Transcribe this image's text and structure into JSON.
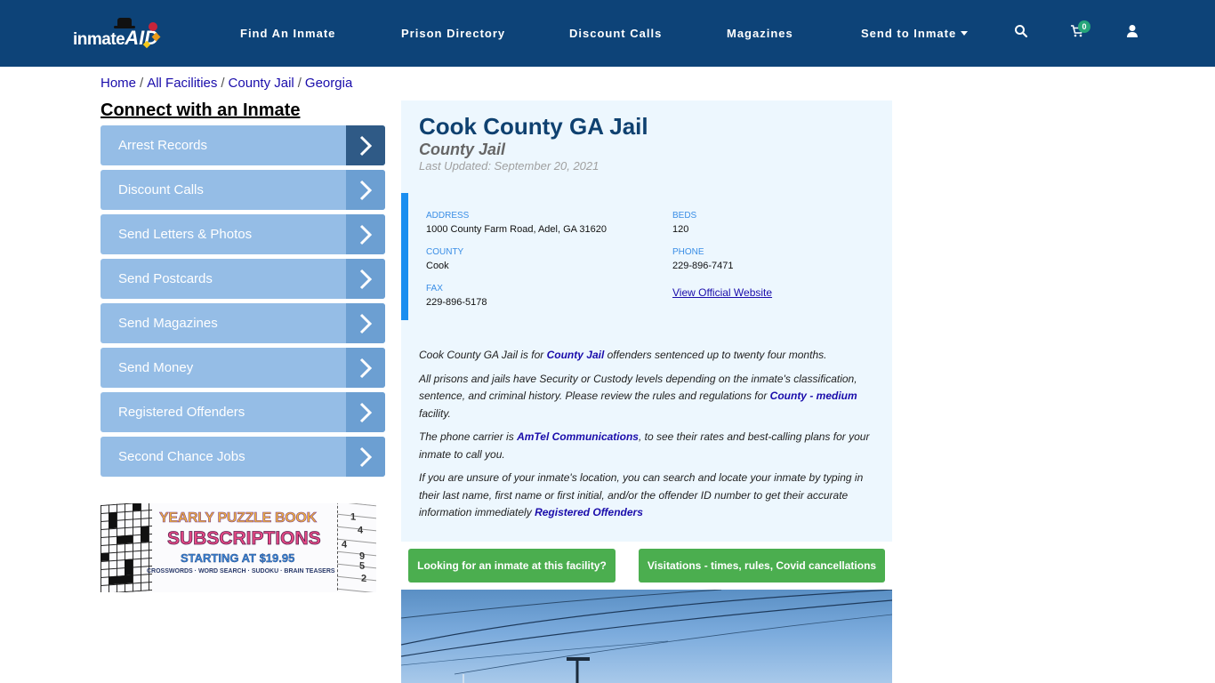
{
  "header": {
    "logo": {
      "text_left": "inmate",
      "text_right": "AID"
    },
    "nav": [
      {
        "label": "Find An Inmate"
      },
      {
        "label": "Prison Directory"
      },
      {
        "label": "Discount Calls"
      },
      {
        "label": "Magazines"
      },
      {
        "label": "Send to Inmate",
        "has_dropdown": true
      }
    ],
    "icons": {
      "search": "search-icon",
      "cart": "cart-icon",
      "user": "user-icon"
    },
    "cart_count": "0"
  },
  "breadcrumb": [
    {
      "label": "Home"
    },
    {
      "label": "All Facilities"
    },
    {
      "label": "County Jail"
    },
    {
      "label": "Georgia"
    }
  ],
  "breadcrumb_separator": "/",
  "sidebar": {
    "title": "Connect with an Inmate",
    "items": [
      {
        "label": "Arrest Records"
      },
      {
        "label": "Discount Calls"
      },
      {
        "label": "Send Letters & Photos"
      },
      {
        "label": "Send Postcards"
      },
      {
        "label": "Send Magazines"
      },
      {
        "label": "Send Money"
      },
      {
        "label": "Registered Offenders"
      },
      {
        "label": "Second Chance Jobs"
      }
    ],
    "ad": {
      "line1": "YEARLY PUZZLE BOOK",
      "line2": "SUBSCRIPTIONS",
      "line3": "STARTING AT $19.95",
      "line4": "CROSSWORDS · WORD SEARCH · SUDOKU · BRAIN TEASERS",
      "sudoku_digits": [
        "1",
        "4",
        "4",
        "9",
        "5",
        "2"
      ]
    }
  },
  "facility": {
    "title": "Cook County GA Jail",
    "type": "County Jail",
    "last_updated": "Last Updated: September 20, 2021",
    "info": {
      "address_label": "ADDRESS",
      "address": "1000 County Farm Road, Adel, GA 31620",
      "county_label": "COUNTY",
      "county": "Cook",
      "fax_label": "FAX",
      "fax": "229-896-5178",
      "beds_label": "BEDS",
      "beds": "120",
      "phone_label": "PHONE",
      "phone": "229-896-7471",
      "website_link": "View Official Website"
    },
    "description": {
      "p1_before": "Cook County GA Jail is for ",
      "p1_link": "County Jail",
      "p1_after": " offenders sentenced up to twenty four months.",
      "p2_before": "All prisons and jails have Security or Custody levels depending on the inmate's classification, sentence, and criminal history. Please review the rules and regulations for ",
      "p2_link": "County - medium",
      "p2_after": " facility.",
      "p3_before": "The phone carrier is ",
      "p3_link": "AmTel Communications",
      "p3_after": ", to see their rates and best-calling plans for your inmate to call you.",
      "p4_before": "If you are unsure of your inmate's location, you can search and locate your inmate by typing in their last name, first name or first initial, and/or the offender ID number to get their accurate information immediately ",
      "p4_link": "Registered Offenders"
    }
  },
  "buttons": {
    "find_inmate": "Looking for an inmate at this facility?",
    "visitations": "Visitations - times, rules, Covid cancellations"
  },
  "colors": {
    "header_bg": "#0d4378",
    "sidebar_item": "#95bde6",
    "sidebar_arrow": "#6c9fd2",
    "sidebar_arrow_active": "#2f5a86",
    "panel_bg": "#edf7fe",
    "accent_bar": "#1a8ef0",
    "green_button": "#4bae4f",
    "link": "#1a0dab"
  }
}
